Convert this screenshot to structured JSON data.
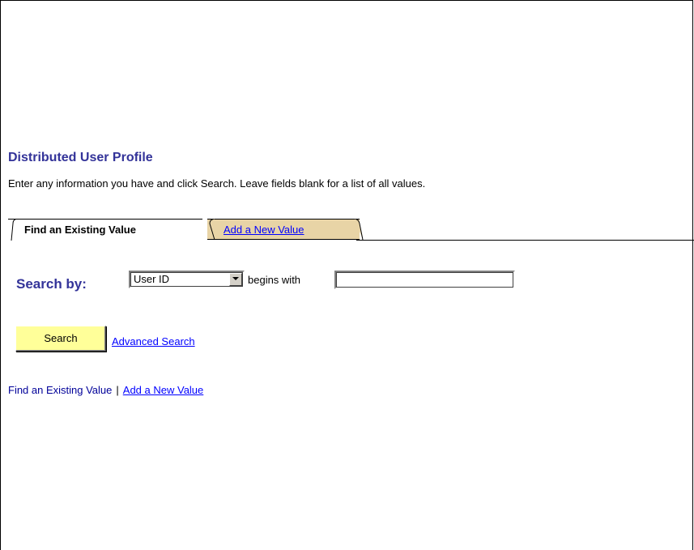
{
  "page": {
    "title": "Distributed User Profile",
    "instructions": "Enter any information you have and click Search. Leave fields blank for a list of all values."
  },
  "tabs": [
    {
      "label": "Find an Existing Value",
      "active": true
    },
    {
      "label": "Add a New Value",
      "active": false
    }
  ],
  "search": {
    "label": "Search by:",
    "field_selected": "User ID",
    "operator": "begins with",
    "value": ""
  },
  "buttons": {
    "search": "Search",
    "advanced": "Advanced Search"
  },
  "bottom_links": {
    "current": "Find an Existing Value",
    "separator": "|",
    "add_new": "Add a New Value"
  },
  "colors": {
    "title": "#333399",
    "link": "#0000ff",
    "inactive_tab": "#e8d4a6",
    "search_button": "#ffff99"
  },
  "icons": {
    "dropdown": "chevron-down-icon"
  }
}
